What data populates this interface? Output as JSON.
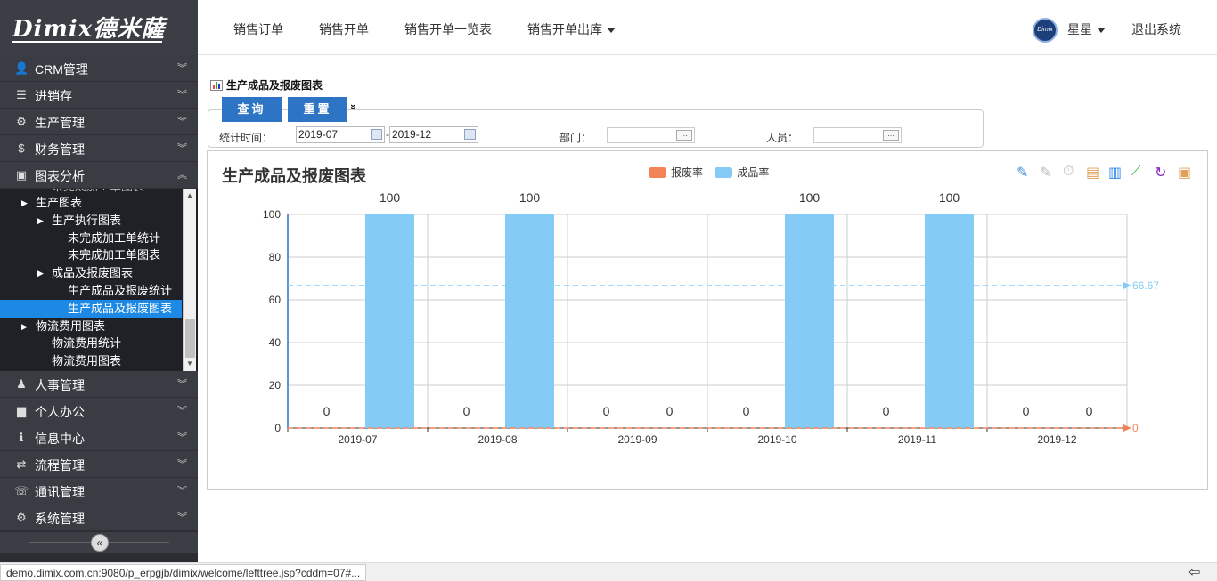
{
  "logo": {
    "brand": "Dimix德米薩"
  },
  "sidebar": {
    "menu": [
      {
        "label": "CRM管理",
        "icon": "user-icon",
        "glyph": "👤"
      },
      {
        "label": "进销存",
        "icon": "list-icon",
        "glyph": "☰"
      },
      {
        "label": "生产管理",
        "icon": "cogs-icon",
        "glyph": "⚙"
      },
      {
        "label": "财务管理",
        "icon": "dollar-icon",
        "glyph": "$"
      },
      {
        "label": "图表分析",
        "icon": "picture-icon",
        "glyph": "▣"
      }
    ],
    "menu_bottom": [
      {
        "label": "人事管理",
        "icon": "people-icon",
        "glyph": "♟"
      },
      {
        "label": "个人办公",
        "icon": "briefcase-icon",
        "glyph": "▆"
      },
      {
        "label": "信息中心",
        "icon": "info-icon",
        "glyph": "ℹ"
      },
      {
        "label": "流程管理",
        "icon": "exchange-icon",
        "glyph": "⇄"
      },
      {
        "label": "通讯管理",
        "icon": "comments-icon",
        "glyph": "☏"
      },
      {
        "label": "系统管理",
        "icon": "gear-icon",
        "glyph": "⚙"
      }
    ],
    "tree": [
      {
        "label": "生产图表",
        "level": 1,
        "branch": true
      },
      {
        "label": "生产执行图表",
        "level": 2,
        "branch": true
      },
      {
        "label": "未完成加工单统计",
        "level": 3,
        "branch": false
      },
      {
        "label": "未完成加工单图表",
        "level": 3,
        "branch": false
      },
      {
        "label": "成品及报废图表",
        "level": 2,
        "branch": true
      },
      {
        "label": "生产成品及报废统计",
        "level": 3,
        "branch": false
      },
      {
        "label": "生产成品及报废图表",
        "level": 3,
        "branch": false,
        "selected": true
      },
      {
        "label": "物流费用图表",
        "level": 1,
        "branch": true
      },
      {
        "label": "物流费用统计",
        "level": 2,
        "branch": false
      },
      {
        "label": "物流费用图表",
        "level": 2,
        "branch": false
      }
    ],
    "collapse_glyph": "«"
  },
  "topbar": {
    "nav": [
      "销售订单",
      "销售开单",
      "销售开单一览表",
      "销售开单出库"
    ],
    "user": "星星",
    "logout": "退出系统",
    "avatar_text": "Dimix"
  },
  "page": {
    "title": "生产成品及报废图表",
    "query_btn": "查询",
    "reset_btn": "重置",
    "expand_glyph": "»",
    "filters": {
      "time_label": "统计时间：",
      "from": "2019-07",
      "to": "2019-12",
      "sep": "-",
      "dept_label": "部门：",
      "person_label": "人员："
    }
  },
  "chart_data": {
    "type": "bar",
    "title": "生产成品及报废图表",
    "categories": [
      "2019-07",
      "2019-08",
      "2019-09",
      "2019-10",
      "2019-11",
      "2019-12"
    ],
    "series": [
      {
        "name": "报废率",
        "color": "#f5835a",
        "values": [
          0,
          0,
          0,
          0,
          0,
          0
        ]
      },
      {
        "name": "成品率",
        "color": "#84cbf5",
        "values": [
          100,
          100,
          0,
          100,
          100,
          0
        ]
      }
    ],
    "ylim": [
      0,
      100
    ],
    "yticks": [
      0,
      20,
      40,
      60,
      80,
      100
    ],
    "mark_lines": [
      {
        "series": "成品率",
        "value": 66.67,
        "label": "66.67"
      },
      {
        "series": "报废率",
        "value": 0,
        "label": "0"
      }
    ],
    "grid": true,
    "legend_position": "top-center"
  },
  "toolbox": [
    "pencil-icon",
    "eraser-icon",
    "timer-icon",
    "data-view-icon",
    "bar-chart-icon",
    "line-chart-icon",
    "refresh-icon",
    "save-icon"
  ],
  "status": {
    "url": "demo.dimix.com.cn:9080/p_erpgjb/dimix/welcome/lefttree.jsp?cddm=07#..."
  }
}
